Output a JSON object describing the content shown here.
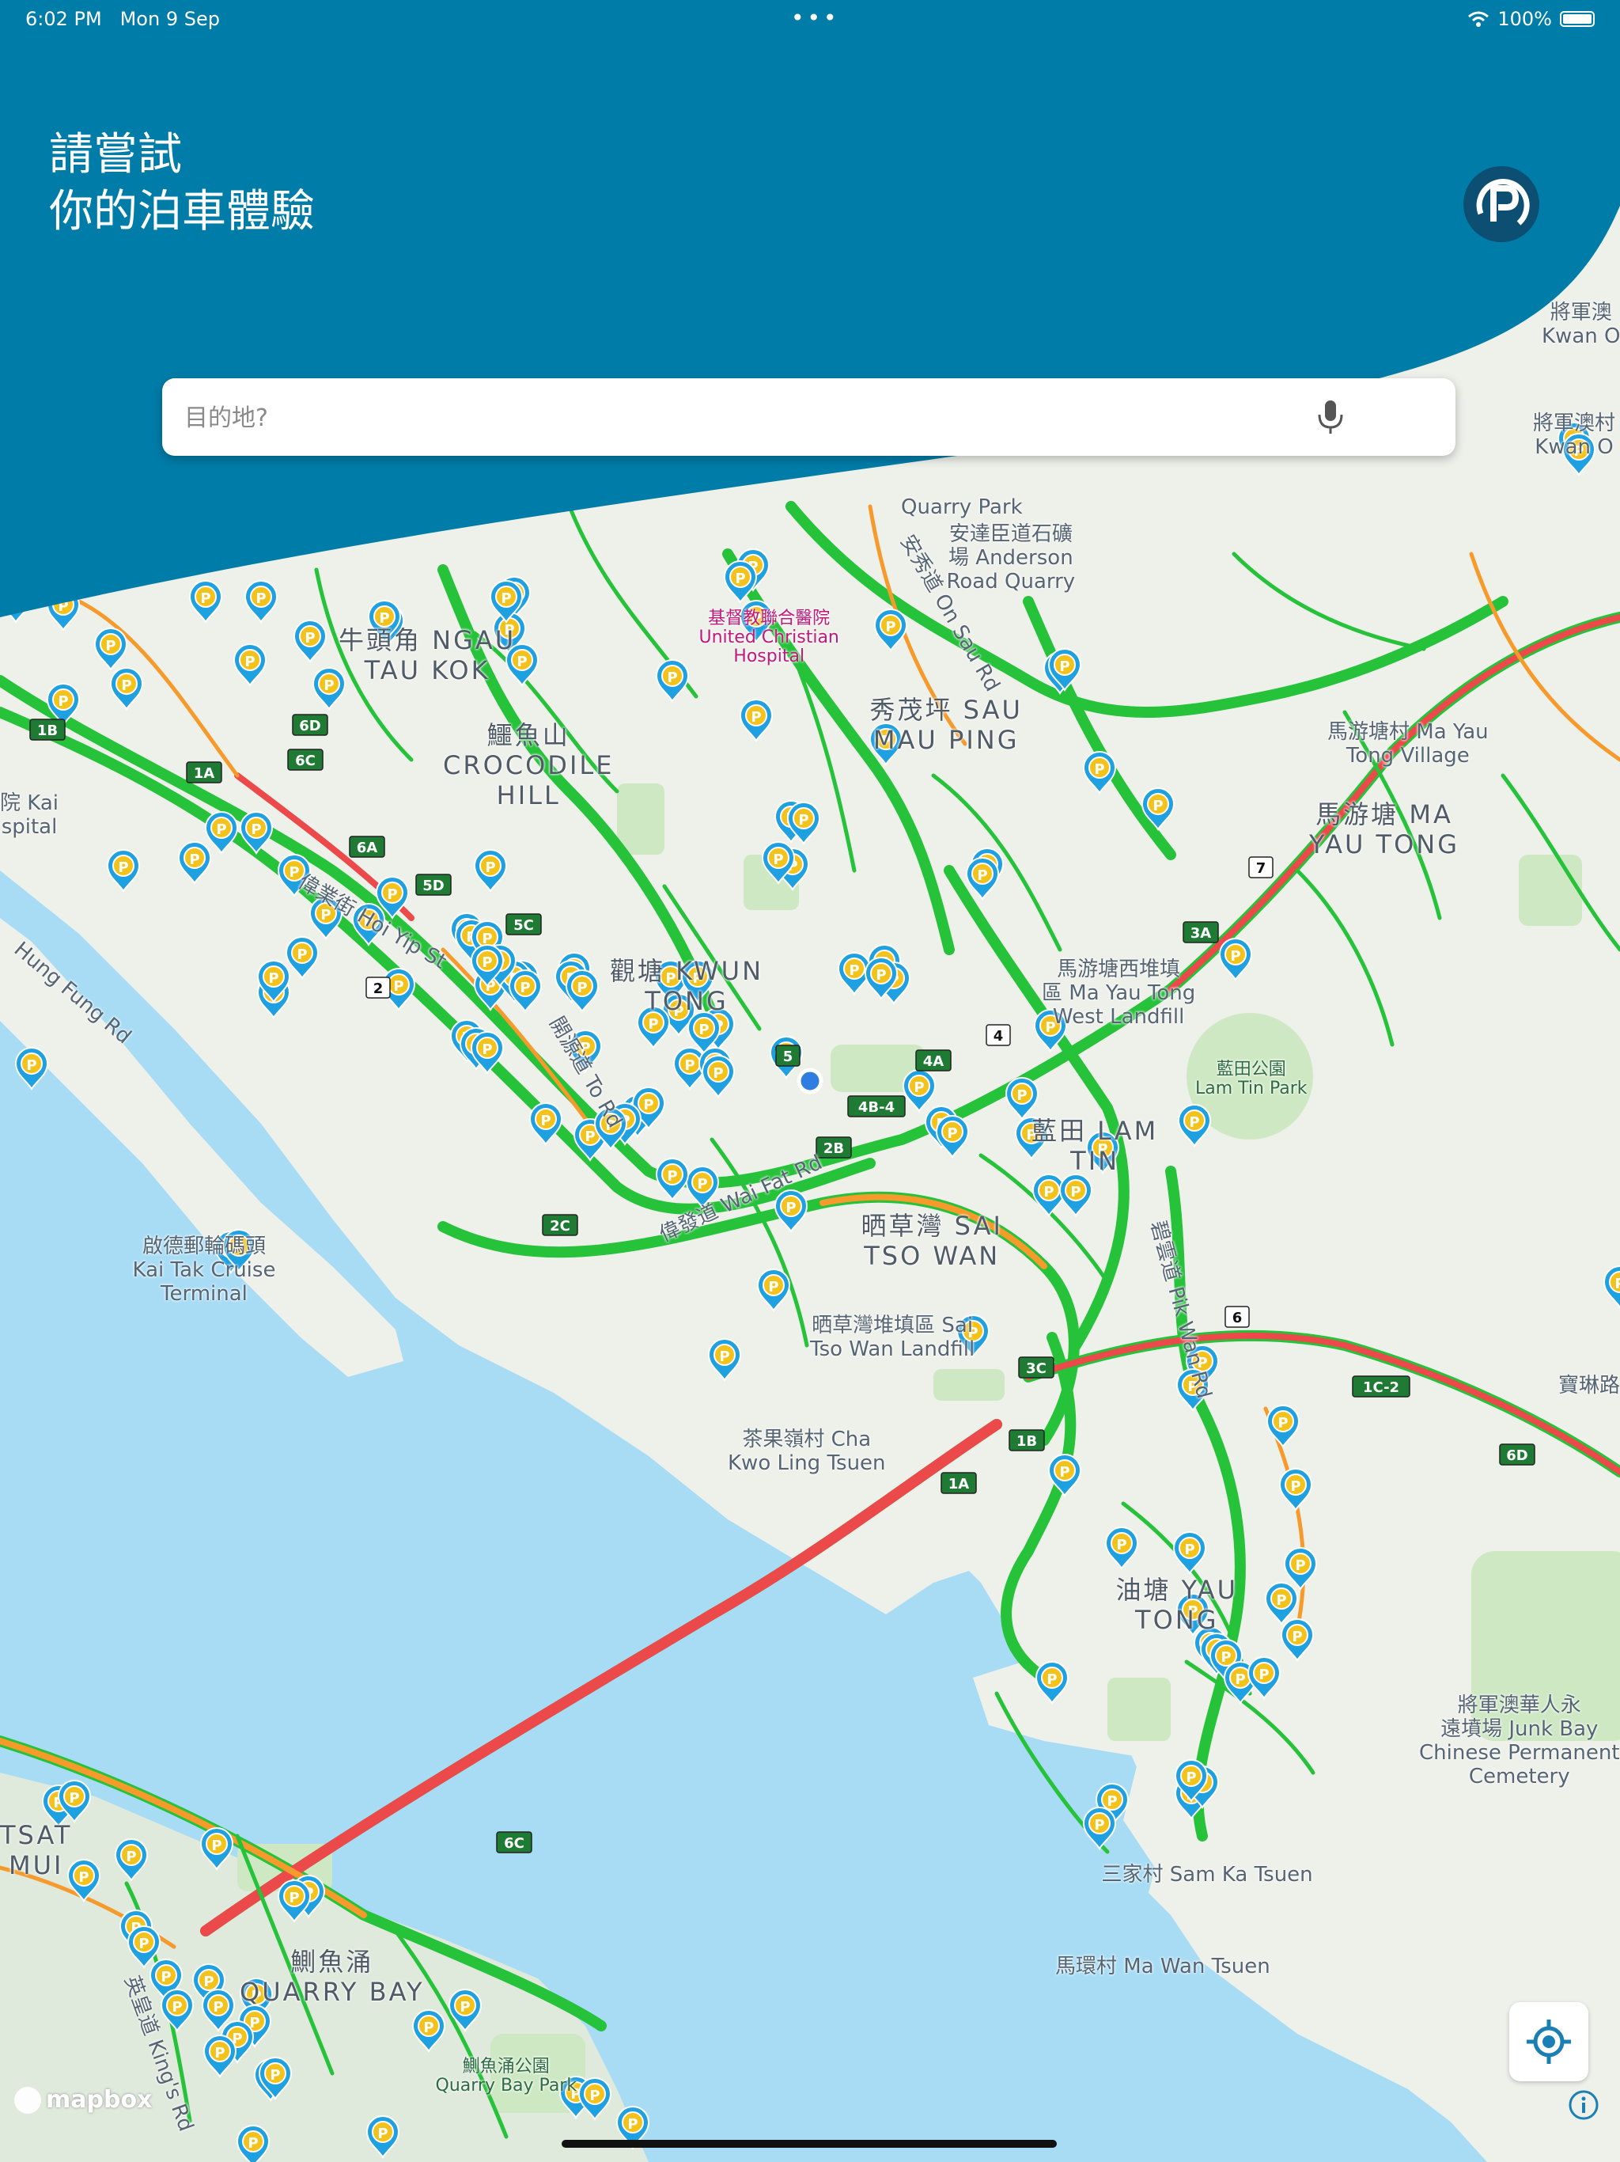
{
  "status_bar": {
    "time": "6:02 PM",
    "date": "Mon 9 Sep",
    "battery": "100%"
  },
  "header": {
    "headline_line1": "請嘗試",
    "headline_line2": "你的泊車體驗"
  },
  "search": {
    "placeholder": "目的地?"
  },
  "map": {
    "attribution": "mapbox",
    "colors": {
      "header_bg": "#007ca8",
      "water": "#a8dcf5",
      "land": "#eef0ea",
      "park": "#cfe8c4",
      "road_free": "#25c23a",
      "road_slow": "#f59a2b",
      "road_jam": "#ec4a4a",
      "pin": "#1fa0e0",
      "pin_p": "#f3c21b"
    },
    "labels": [
      {
        "id": "ngau_tau_kok",
        "text": "牛頭角 NGAU\nTAU KOK"
      },
      {
        "id": "united_christian_hospital",
        "text": "基督教聯合醫院\nUnited Christian\nHospital"
      },
      {
        "id": "anderson_road_quarry",
        "text": "安達臣道石礦\n場 Anderson\nRoad Quarry"
      },
      {
        "id": "quarry_park",
        "text": "Quarry Park"
      },
      {
        "id": "on_sau_rd",
        "text": "安秀道 On Sau Rd"
      },
      {
        "id": "sau_mau_ping",
        "text": "秀茂坪 SAU\nMAU PING"
      },
      {
        "id": "crocodile_hill",
        "text": "鱷魚山\nCROCODILE\nHILL"
      },
      {
        "id": "ma_yau_tong_village",
        "text": "馬游塘村 Ma Yau\nTong Village"
      },
      {
        "id": "ma_yau_tong",
        "text": "馬游塘 MA\nYAU TONG"
      },
      {
        "id": "kwun_tong",
        "text": "觀塘 KWUN\nTONG"
      },
      {
        "id": "kai_tak_hospital",
        "text": "院 Kai\nspital"
      },
      {
        "id": "hung_fung_rd",
        "text": "Hung Fung Rd"
      },
      {
        "id": "hoi_yip_st",
        "text": "偉業街 Hoi Yip St"
      },
      {
        "id": "hoi_bun_rd",
        "text": "開源道 To Rd"
      },
      {
        "id": "ma_yau_tong_west_landfill",
        "text": "馬游塘西堆填\n區 Ma Yau Tong\nWest Landfill"
      },
      {
        "id": "lam_tin_park",
        "text": "藍田公園\nLam Tin Park"
      },
      {
        "id": "lam_tin",
        "text": "藍田 LAM\nTIN"
      },
      {
        "id": "kai_tak_terminal",
        "text": "啟德郵輪碼頭\nKai Tak Cruise\nTerminal"
      },
      {
        "id": "wai_fat_rd",
        "text": "偉發道 Wai Fat Rd"
      },
      {
        "id": "sai_tso_wan",
        "text": "晒草灣 SAI\nTSO WAN"
      },
      {
        "id": "sai_tso_wan_landfill",
        "text": "晒草灣堆填區 Sai\nTso Wan Landfill"
      },
      {
        "id": "pik_wan_rd",
        "text": "碧雲道 Pik Wan Rd"
      },
      {
        "id": "cha_kwo_ling",
        "text": "茶果嶺村 Cha\nKwo Ling Tsuen"
      },
      {
        "id": "yau_tong",
        "text": "油塘 YAU\nTONG"
      },
      {
        "id": "junk_bay_cemetery",
        "text": "將軍澳華人永\n遠墳場 Junk Bay\nChinese Permanent\nCemetery"
      },
      {
        "id": "sam_ka_tsuen",
        "text": "三家村 Sam Ka Tsuen"
      },
      {
        "id": "ma_wan_tsuen",
        "text": "馬環村 Ma Wan Tsuen"
      },
      {
        "id": "tseung_kwan_o_1",
        "text": "將軍澳\nKwan O"
      },
      {
        "id": "tseung_kwan_o_2",
        "text": "將軍澳村\nKwan O"
      },
      {
        "id": "tsat_tsz_mui",
        "text": "TSAT\nMUI"
      },
      {
        "id": "quarry_bay",
        "text": "鰂魚涌\nQUARRY BAY"
      },
      {
        "id": "quarry_bay_park",
        "text": "鰂魚涌公園\nQuarry Bay Park"
      },
      {
        "id": "kings_rd",
        "text": "英皇道 King's Rd"
      },
      {
        "id": "po_lam_rd",
        "text": "寶琳路"
      }
    ],
    "route_shields": [
      "1B",
      "1A",
      "6D",
      "6C",
      "6A",
      "5D",
      "5C",
      "2",
      "7",
      "3A",
      "4",
      "4A",
      "4B-4",
      "5",
      "2B",
      "2C",
      "6",
      "1C-2",
      "3C"
    ]
  }
}
